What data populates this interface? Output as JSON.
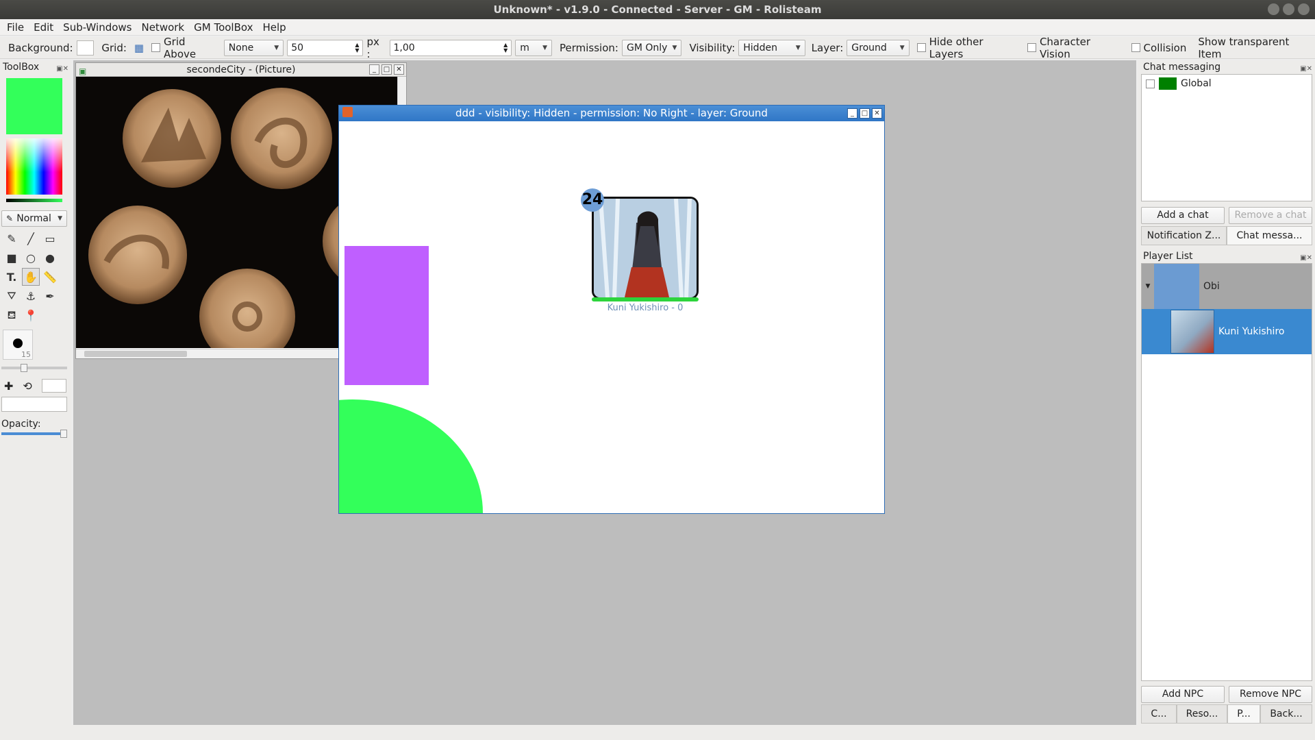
{
  "window": {
    "title": "Unknown* - v1.9.0 - Connected - Server - GM - Rolisteam"
  },
  "menu": [
    "File",
    "Edit",
    "Sub-Windows",
    "Network",
    "GM ToolBox",
    "Help"
  ],
  "toolbar": {
    "background_label": "Background:",
    "grid_label": "Grid:",
    "grid_above_label": "Grid Above",
    "grid_pattern": "None",
    "grid_size": "50",
    "px_label": "px :",
    "scale": "1,00",
    "unit": "m",
    "permission_label": "Permission:",
    "permission_value": "GM Only",
    "visibility_label": "Visibility:",
    "visibility_value": "Hidden",
    "layer_label": "Layer:",
    "layer_value": "Ground",
    "hide_layers_label": "Hide other Layers",
    "character_vision_label": "Character Vision",
    "collision_label": "Collision",
    "show_transparent_label": "Show transparent Item"
  },
  "toolbox": {
    "title": "ToolBox",
    "color_current": "#33ff5a",
    "mode": "Normal",
    "pen_size": "15",
    "opacity_label": "Opacity:"
  },
  "picture_window": {
    "title": "secondeCity - (Picture)"
  },
  "map_window": {
    "title": "ddd - visibility: Hidden - permission: No Right - layer: Ground",
    "token_number": "24",
    "token_caption": "Kuni Yukishiro - 0",
    "rect_color": "#bf5fff",
    "ellipse_color": "#33ff5a"
  },
  "chat": {
    "title": "Chat messaging",
    "items": [
      {
        "label": "Global",
        "color": "#008000"
      }
    ],
    "add_button": "Add a chat",
    "remove_button": "Remove a chat",
    "tabs": [
      "Notification Z...",
      "Chat messa..."
    ]
  },
  "players": {
    "title": "Player List",
    "items": [
      {
        "label": "Obi",
        "color": "#6b9bd2"
      },
      {
        "label": "Kuni Yukishiro"
      }
    ],
    "add_button": "Add NPC",
    "remove_button": "Remove NPC",
    "tabs": [
      "C...",
      "Reso...",
      "P...",
      "Back..."
    ]
  }
}
